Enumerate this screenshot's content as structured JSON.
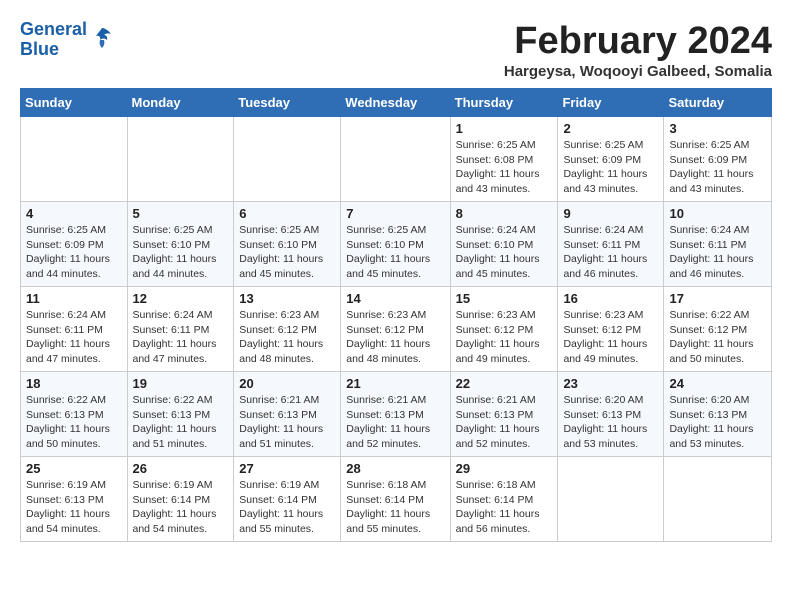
{
  "logo": {
    "line1": "General",
    "line2": "Blue"
  },
  "title": "February 2024",
  "location": "Hargeysa, Woqooyi Galbeed, Somalia",
  "days_of_week": [
    "Sunday",
    "Monday",
    "Tuesday",
    "Wednesday",
    "Thursday",
    "Friday",
    "Saturday"
  ],
  "weeks": [
    [
      {
        "day": "",
        "detail": ""
      },
      {
        "day": "",
        "detail": ""
      },
      {
        "day": "",
        "detail": ""
      },
      {
        "day": "",
        "detail": ""
      },
      {
        "day": "1",
        "detail": "Sunrise: 6:25 AM\nSunset: 6:08 PM\nDaylight: 11 hours\nand 43 minutes."
      },
      {
        "day": "2",
        "detail": "Sunrise: 6:25 AM\nSunset: 6:09 PM\nDaylight: 11 hours\nand 43 minutes."
      },
      {
        "day": "3",
        "detail": "Sunrise: 6:25 AM\nSunset: 6:09 PM\nDaylight: 11 hours\nand 43 minutes."
      }
    ],
    [
      {
        "day": "4",
        "detail": "Sunrise: 6:25 AM\nSunset: 6:09 PM\nDaylight: 11 hours\nand 44 minutes."
      },
      {
        "day": "5",
        "detail": "Sunrise: 6:25 AM\nSunset: 6:10 PM\nDaylight: 11 hours\nand 44 minutes."
      },
      {
        "day": "6",
        "detail": "Sunrise: 6:25 AM\nSunset: 6:10 PM\nDaylight: 11 hours\nand 45 minutes."
      },
      {
        "day": "7",
        "detail": "Sunrise: 6:25 AM\nSunset: 6:10 PM\nDaylight: 11 hours\nand 45 minutes."
      },
      {
        "day": "8",
        "detail": "Sunrise: 6:24 AM\nSunset: 6:10 PM\nDaylight: 11 hours\nand 45 minutes."
      },
      {
        "day": "9",
        "detail": "Sunrise: 6:24 AM\nSunset: 6:11 PM\nDaylight: 11 hours\nand 46 minutes."
      },
      {
        "day": "10",
        "detail": "Sunrise: 6:24 AM\nSunset: 6:11 PM\nDaylight: 11 hours\nand 46 minutes."
      }
    ],
    [
      {
        "day": "11",
        "detail": "Sunrise: 6:24 AM\nSunset: 6:11 PM\nDaylight: 11 hours\nand 47 minutes."
      },
      {
        "day": "12",
        "detail": "Sunrise: 6:24 AM\nSunset: 6:11 PM\nDaylight: 11 hours\nand 47 minutes."
      },
      {
        "day": "13",
        "detail": "Sunrise: 6:23 AM\nSunset: 6:12 PM\nDaylight: 11 hours\nand 48 minutes."
      },
      {
        "day": "14",
        "detail": "Sunrise: 6:23 AM\nSunset: 6:12 PM\nDaylight: 11 hours\nand 48 minutes."
      },
      {
        "day": "15",
        "detail": "Sunrise: 6:23 AM\nSunset: 6:12 PM\nDaylight: 11 hours\nand 49 minutes."
      },
      {
        "day": "16",
        "detail": "Sunrise: 6:23 AM\nSunset: 6:12 PM\nDaylight: 11 hours\nand 49 minutes."
      },
      {
        "day": "17",
        "detail": "Sunrise: 6:22 AM\nSunset: 6:12 PM\nDaylight: 11 hours\nand 50 minutes."
      }
    ],
    [
      {
        "day": "18",
        "detail": "Sunrise: 6:22 AM\nSunset: 6:13 PM\nDaylight: 11 hours\nand 50 minutes."
      },
      {
        "day": "19",
        "detail": "Sunrise: 6:22 AM\nSunset: 6:13 PM\nDaylight: 11 hours\nand 51 minutes."
      },
      {
        "day": "20",
        "detail": "Sunrise: 6:21 AM\nSunset: 6:13 PM\nDaylight: 11 hours\nand 51 minutes."
      },
      {
        "day": "21",
        "detail": "Sunrise: 6:21 AM\nSunset: 6:13 PM\nDaylight: 11 hours\nand 52 minutes."
      },
      {
        "day": "22",
        "detail": "Sunrise: 6:21 AM\nSunset: 6:13 PM\nDaylight: 11 hours\nand 52 minutes."
      },
      {
        "day": "23",
        "detail": "Sunrise: 6:20 AM\nSunset: 6:13 PM\nDaylight: 11 hours\nand 53 minutes."
      },
      {
        "day": "24",
        "detail": "Sunrise: 6:20 AM\nSunset: 6:13 PM\nDaylight: 11 hours\nand 53 minutes."
      }
    ],
    [
      {
        "day": "25",
        "detail": "Sunrise: 6:19 AM\nSunset: 6:13 PM\nDaylight: 11 hours\nand 54 minutes."
      },
      {
        "day": "26",
        "detail": "Sunrise: 6:19 AM\nSunset: 6:14 PM\nDaylight: 11 hours\nand 54 minutes."
      },
      {
        "day": "27",
        "detail": "Sunrise: 6:19 AM\nSunset: 6:14 PM\nDaylight: 11 hours\nand 55 minutes."
      },
      {
        "day": "28",
        "detail": "Sunrise: 6:18 AM\nSunset: 6:14 PM\nDaylight: 11 hours\nand 55 minutes."
      },
      {
        "day": "29",
        "detail": "Sunrise: 6:18 AM\nSunset: 6:14 PM\nDaylight: 11 hours\nand 56 minutes."
      },
      {
        "day": "",
        "detail": ""
      },
      {
        "day": "",
        "detail": ""
      }
    ]
  ]
}
